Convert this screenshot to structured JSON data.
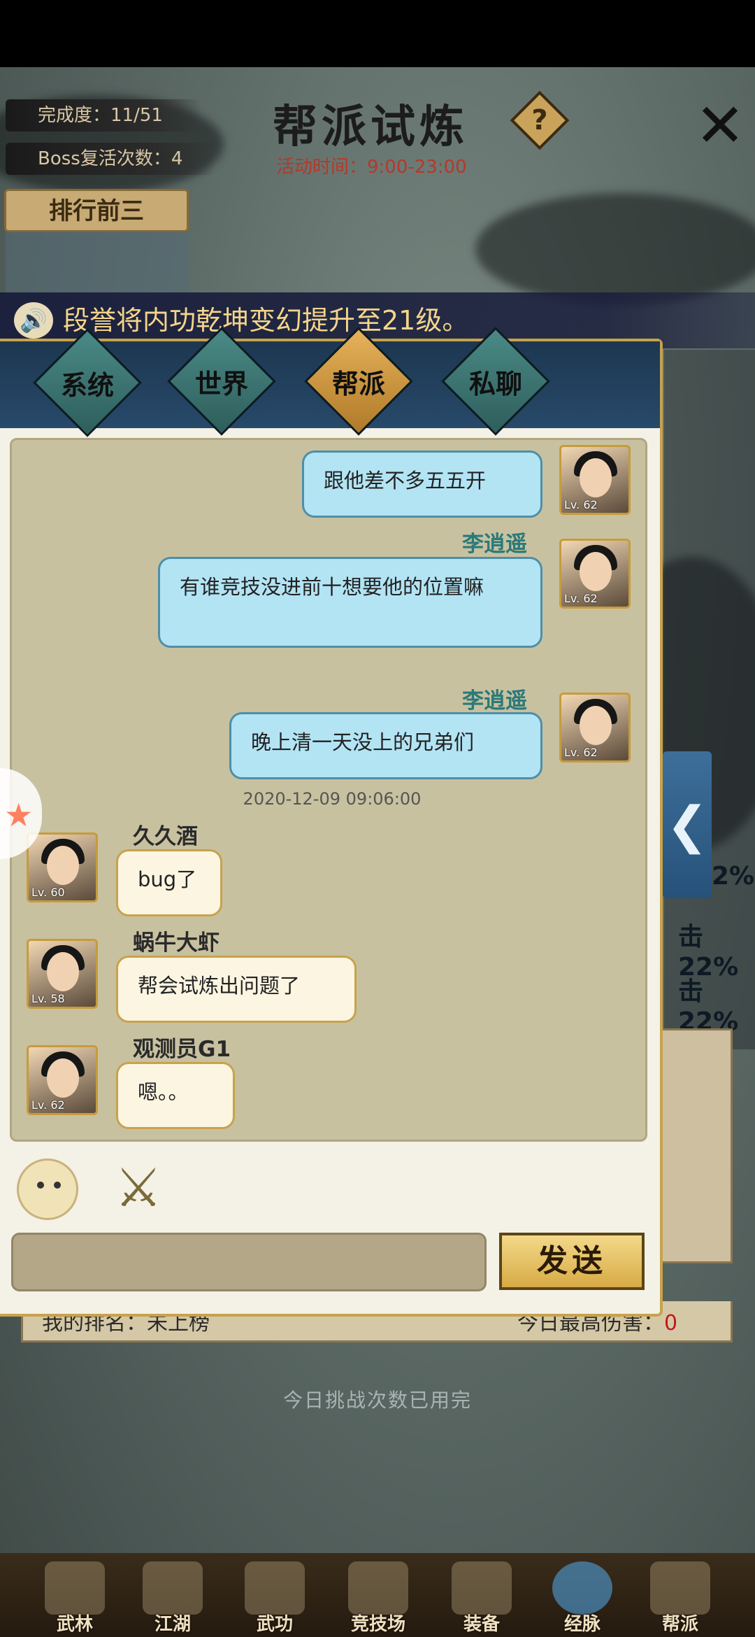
{
  "header": {
    "progress_label": "完成度：11/51",
    "boss_revive_label": "Boss复活次数：4",
    "title": "帮派试炼",
    "activity_time": "活动时间：9:00-23:00",
    "help_icon": "?",
    "close_icon": "✕",
    "top3_label": "排行前三"
  },
  "marquee": {
    "icon": "speaker-icon",
    "text": "段誉将内功乾坤变幻提升至21级。"
  },
  "chat_tabs": [
    {
      "label": "系统",
      "active": false
    },
    {
      "label": "世界",
      "active": false
    },
    {
      "label": "帮派",
      "active": true
    },
    {
      "label": "私聊",
      "active": false
    }
  ],
  "messages": [
    {
      "side": "right",
      "name": "",
      "text": "跟他差不多五五开",
      "level": "Lv. 62"
    },
    {
      "side": "right",
      "name": "李逍遥",
      "text": "有谁竞技没进前十想要他的位置嘛",
      "level": "Lv. 62"
    },
    {
      "side": "right",
      "name": "李逍遥",
      "text": "晚上清一天没上的兄弟们",
      "level": "Lv. 62"
    },
    {
      "side": "left",
      "name": "久久酒",
      "text": "bug了",
      "level": "Lv. 60"
    },
    {
      "side": "left",
      "name": "蜗牛大虾",
      "text": "帮会试炼出问题了",
      "level": "Lv. 58"
    },
    {
      "side": "left",
      "name": "观测员G1",
      "text": "嗯。。",
      "level": "Lv. 62"
    }
  ],
  "timestamp": "2020-12-09  09:06:00",
  "input": {
    "placeholder": "",
    "send_label": "发送"
  },
  "background": {
    "percent_1": "2%",
    "percent_2": "击22%",
    "percent_3": "击22%",
    "arrow": "❮",
    "best_damage_label": "今日最高伤害：",
    "best_damage_value": "0",
    "my_rank_label": "我的排名：未上榜",
    "today_used": "今日挑战次数已用完"
  },
  "bottom_nav": [
    "武林",
    "江湖",
    "武功",
    "竞技场",
    "装备",
    "经脉",
    "帮派"
  ],
  "colors": {
    "accent_gold": "#c8a24c",
    "bubble_self": "#b3e4f4",
    "bubble_other": "#fcf5e2",
    "title_time": "#b23a2a"
  }
}
